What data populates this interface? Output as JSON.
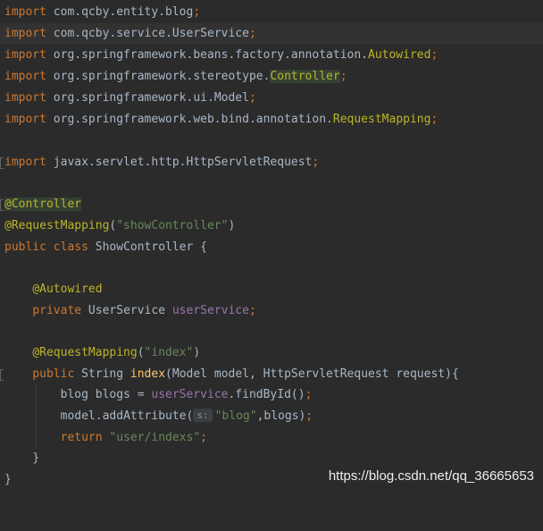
{
  "editor": {
    "import_kw": "import",
    "imports": [
      {
        "pre": " com.qcby.entity.",
        "name": "blog",
        "semi": ";"
      },
      {
        "pre": " com.qcby.service.",
        "name": "UserService",
        "semi": ";"
      },
      {
        "pre": " org.springframework.beans.factory.annotation.",
        "name": "Autowired",
        "semi": ";"
      },
      {
        "pre": " org.springframework.stereotype.",
        "name": "Controller",
        "semi": ";"
      },
      {
        "pre": " org.springframework.ui.",
        "name": "Model",
        "semi": ";"
      },
      {
        "pre": " org.springframework.web.bind.annotation.",
        "name": "RequestMapping",
        "semi": ";"
      },
      {
        "pre": " javax.servlet.http.",
        "name": "HttpServletRequest",
        "semi": ";"
      }
    ],
    "ann_controller": "@Controller",
    "ann_requestmapping": "@RequestMapping",
    "class_mapping_arg": "\"showController\"",
    "kw_public": "public",
    "kw_class": "class",
    "class_name": " ShowController {",
    "ann_autowired": "@Autowired",
    "kw_private": "private",
    "field_type": " UserService ",
    "field_name": "userService",
    "method_mapping_arg": "\"index\"",
    "ret_type": " String ",
    "method_name": "index",
    "params": "(Model model, HttpServletRequest request){",
    "local_decl": "blog blogs = ",
    "call_rest": ".findById()",
    "model_call": "model.addAttribute(",
    "param_hint": "s:",
    "attr_key": "\"blog\"",
    "attr_rest": ",blogs)",
    "kw_return": "return",
    "return_value": "\"user/indexs\"",
    "close_inner": "}",
    "close_outer": "}",
    "semicolon": ";",
    "paren_open": "(",
    "paren_close": ")"
  },
  "watermark": "https://blog.csdn.net/qq_36665653"
}
